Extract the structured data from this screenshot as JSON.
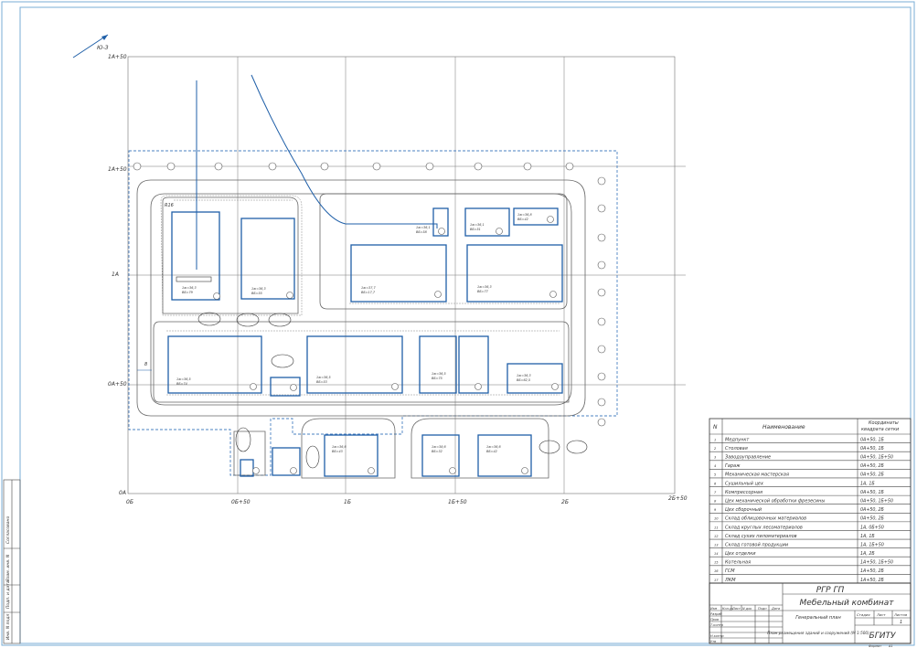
{
  "north_label": "Ю-З",
  "grid": {
    "left_labels": [
      "1А+50",
      "1А+50",
      "1А",
      "0А+50",
      "0А"
    ],
    "bottom_labels": [
      "0Б",
      "0Б+50",
      "1Б",
      "1Б+50",
      "2Б",
      "2Б+50"
    ]
  },
  "dimensions": {
    "radius": "R16",
    "road_width": "8"
  },
  "buildings": [
    {
      "n": "1",
      "elev": [
        "1ж=36,13",
        "ВБ=25"
      ]
    },
    {
      "n": "2",
      "elev": [
        "1ж=36,8",
        "ВБ=27"
      ]
    },
    {
      "n": "3",
      "elev": [
        "1ж=36,6",
        "ВБ=43"
      ]
    },
    {
      "n": "4",
      "elev": [
        "1ж=38,6",
        "ВБ=32"
      ]
    },
    {
      "n": "5",
      "elev": [
        "1ж=36,6",
        "ВБ=42"
      ]
    },
    {
      "n": "6",
      "elev": [
        "1ж=36,5",
        "ВБ=74"
      ]
    },
    {
      "n": "7",
      "elev": [
        "1ж=76,5",
        "ВБ=62"
      ]
    },
    {
      "n": "8",
      "elev": [
        "1ж=36,5",
        "ВБ=53"
      ]
    },
    {
      "n": "9",
      "elev": [
        "1ж=36,5",
        "ВБ=75"
      ]
    },
    {
      "n": "10",
      "elev": [
        "1ж=36,3",
        "ВБ=62,5"
      ]
    },
    {
      "n": "11",
      "elev": [
        "1ж=36,3",
        "ВБ=79"
      ]
    },
    {
      "n": "12",
      "elev": [
        "1ж=36,3",
        "ВБ=55"
      ]
    },
    {
      "n": "13",
      "elev": [
        "1ж=37,7",
        "ВБ=17,7"
      ]
    },
    {
      "n": "14",
      "elev": [
        "1ж=36,3",
        "ВБ=77"
      ]
    },
    {
      "n": "15",
      "elev": [
        "1ж=36,1",
        "ВБ=58"
      ]
    },
    {
      "n": "16",
      "elev": [
        "1ж=36,1",
        "ВБ=51"
      ]
    },
    {
      "n": "17",
      "elev": [
        "1ж=36,8",
        "ВБ=42"
      ]
    }
  ],
  "table": {
    "headers": {
      "n": "N",
      "name": "Наименование",
      "coords": "Координаты квадрата сетки"
    },
    "rows": [
      {
        "n": "1",
        "name": "Медпункт",
        "coords": "0А+50, 1Б"
      },
      {
        "n": "2",
        "name": "Столовая",
        "coords": "0А+50, 1Б"
      },
      {
        "n": "3",
        "name": "Заводоуправление",
        "coords": "0А+50, 1Б+50"
      },
      {
        "n": "4",
        "name": "Гараж",
        "coords": "0А+50, 2Б"
      },
      {
        "n": "5",
        "name": "Механическая мастерская",
        "coords": "0А+50, 2Б"
      },
      {
        "n": "6",
        "name": "Сушильный цех",
        "coords": "1А, 1Б"
      },
      {
        "n": "7",
        "name": "Компрессорная",
        "coords": "0А+50, 1Б"
      },
      {
        "n": "8",
        "name": "Цех механической обработки фрезесины",
        "coords": "0А+50, 1Б+50"
      },
      {
        "n": "9",
        "name": "Цех сборочный",
        "coords": "0А+50, 2Б"
      },
      {
        "n": "10",
        "name": "Склад облицовочных материалов",
        "coords": "0А+50, 2Б"
      },
      {
        "n": "11",
        "name": "Склад круглых лесоматериалов",
        "coords": "1А, 0Б+50"
      },
      {
        "n": "12",
        "name": "Склад сухих пиломатериалов",
        "coords": "1А, 1Б"
      },
      {
        "n": "13",
        "name": "Склад готовой продукции",
        "coords": "1А, 1Б+50"
      },
      {
        "n": "14",
        "name": "Цех отделки",
        "coords": "1А, 2Б"
      },
      {
        "n": "15",
        "name": "Котельная",
        "coords": "1А+50, 1Б+50"
      },
      {
        "n": "16",
        "name": "ГСМ",
        "coords": "1А+50, 2Б"
      },
      {
        "n": "17",
        "name": "ЛКМ",
        "coords": "1А+50, 2Б"
      }
    ]
  },
  "title_block": {
    "code": "РГР ГП",
    "project": "Мебельный комбинат",
    "sheet_name": "Генеральный план",
    "subtitle": "План размещения зданий и сооружений (М 1:500)",
    "stage_label": "Стадия",
    "sheet_label": "Лист",
    "sheets_label": "Листов",
    "sheets_value": "1",
    "org": "БГИТУ",
    "format_label": "Формат",
    "format_value": "А1",
    "row_labels": [
      "Изм",
      "Кол.уч",
      "Лист",
      "N док",
      "Подп",
      "Дата"
    ],
    "roles": [
      "Разраб",
      "Пров",
      "Т.контр",
      "Н.контр",
      "Утв"
    ]
  },
  "side_stamp": [
    "Инв. N подл",
    "Подп. и дата",
    "Взам. инв. N",
    "Согласовано"
  ]
}
